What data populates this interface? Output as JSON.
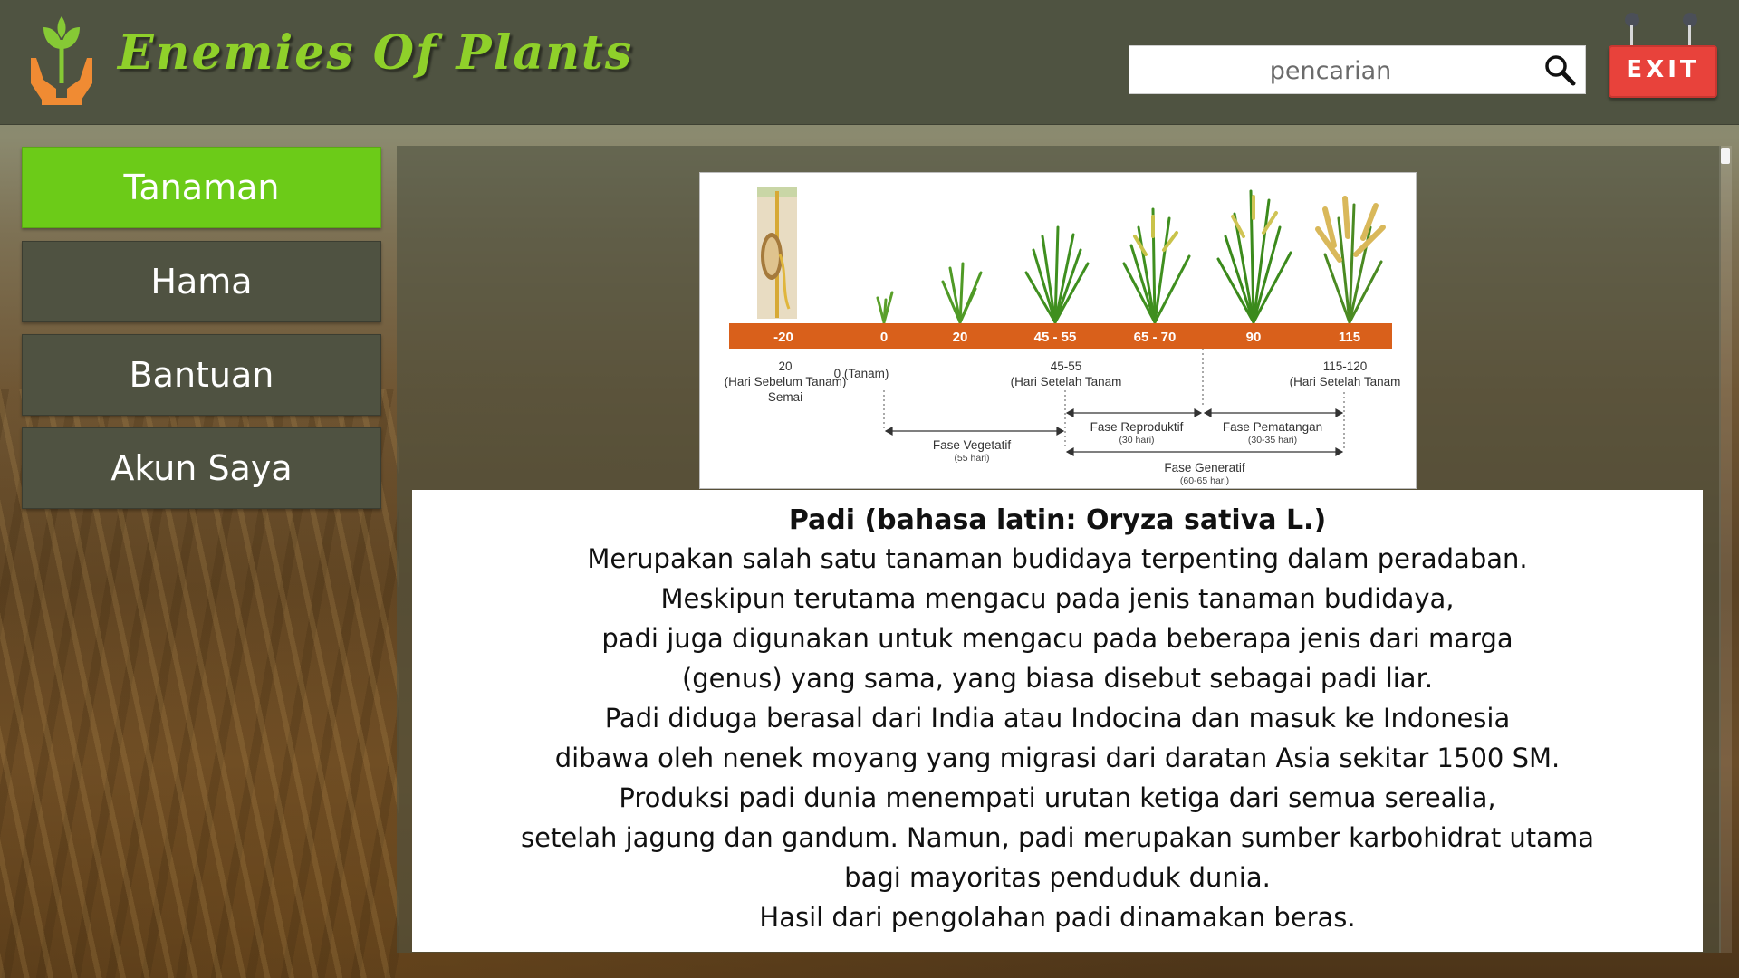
{
  "app": {
    "title": "Enemies Of Plants",
    "logo_icon": "plant-in-hands-icon"
  },
  "search": {
    "placeholder": "pencarian",
    "icon": "magnifier-icon"
  },
  "exit": {
    "label": "EXIT"
  },
  "sidebar": {
    "items": [
      {
        "label": "Tanaman",
        "active": true
      },
      {
        "label": "Hama",
        "active": false
      },
      {
        "label": "Bantuan",
        "active": false
      },
      {
        "label": "Akun Saya",
        "active": false
      }
    ]
  },
  "diagram": {
    "bar_labels": [
      "-20",
      "0",
      "20",
      "45 - 55",
      "65 - 70",
      "90",
      "115"
    ],
    "seedling_note": [
      "20",
      "(Hari Sebelum Tanam)",
      "Semai"
    ],
    "plant_note": "0 (Tanam)",
    "mid_note": [
      "45-55",
      "(Hari Setelah Tanam"
    ],
    "end_note": [
      "115-120",
      "(Hari Setelah Tanam"
    ],
    "phases": {
      "reproduktif": {
        "label": "Fase Reproduktif",
        "duration": "(30 hari)"
      },
      "pematangan": {
        "label": "Fase Pematangan",
        "duration": "(30-35 hari)"
      },
      "vegetatif": {
        "label": "Fase Vegetatif",
        "duration": "(55 hari)"
      },
      "generatif": {
        "label": "Fase Generatif",
        "duration": "(60-65 hari)"
      }
    }
  },
  "description": {
    "title": "Padi (bahasa latin: Oryza sativa L.)",
    "lines": [
      "Merupakan salah satu tanaman budidaya terpenting dalam peradaban.",
      "Meskipun terutama mengacu pada jenis tanaman budidaya,",
      "padi juga digunakan untuk mengacu pada beberapa jenis dari marga",
      "(genus) yang sama, yang biasa disebut sebagai padi liar.",
      "Padi diduga berasal dari India atau Indocina dan masuk ke Indonesia",
      "dibawa oleh nenek moyang yang migrasi dari daratan Asia sekitar 1500 SM.",
      "Produksi padi dunia menempati urutan ketiga dari semua serealia,",
      "setelah jagung dan gandum. Namun, padi merupakan sumber karbohidrat utama",
      "bagi mayoritas penduduk dunia.",
      "Hasil dari pengolahan padi dinamakan beras."
    ]
  },
  "colors": {
    "header_bg": "#4f5341",
    "accent_green": "#6ccb18",
    "title_green": "#8fd02a",
    "exit_red": "#e8423b",
    "timeline_orange": "#d9601b"
  }
}
